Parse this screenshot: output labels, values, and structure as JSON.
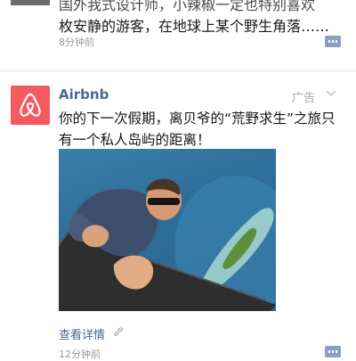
{
  "previous_post": {
    "text_line1": "国外我式设计师，小辣椒一定也特别喜欢",
    "text_line2": "枚安静的游客，在地球上某个野生角落……",
    "time": "8分钟前"
  },
  "ad_post": {
    "advertiser": "Airbnb",
    "ad_label": "广告",
    "text": "你的下一次假期，离贝爷的“荒野求生”之旅只有一个私人岛屿的距离！",
    "details_link": "查看详情",
    "time": "12分钟前"
  },
  "colors": {
    "brand_blue": "#4a6892",
    "airbnb_red": "#f55a5f",
    "meta_gray": "#9a9a9a"
  },
  "icons": {
    "advertiser_logo": "airbnb-logo",
    "ad_menu": "chevron-down-icon",
    "details": "link-icon",
    "comment": "comment-icon"
  }
}
